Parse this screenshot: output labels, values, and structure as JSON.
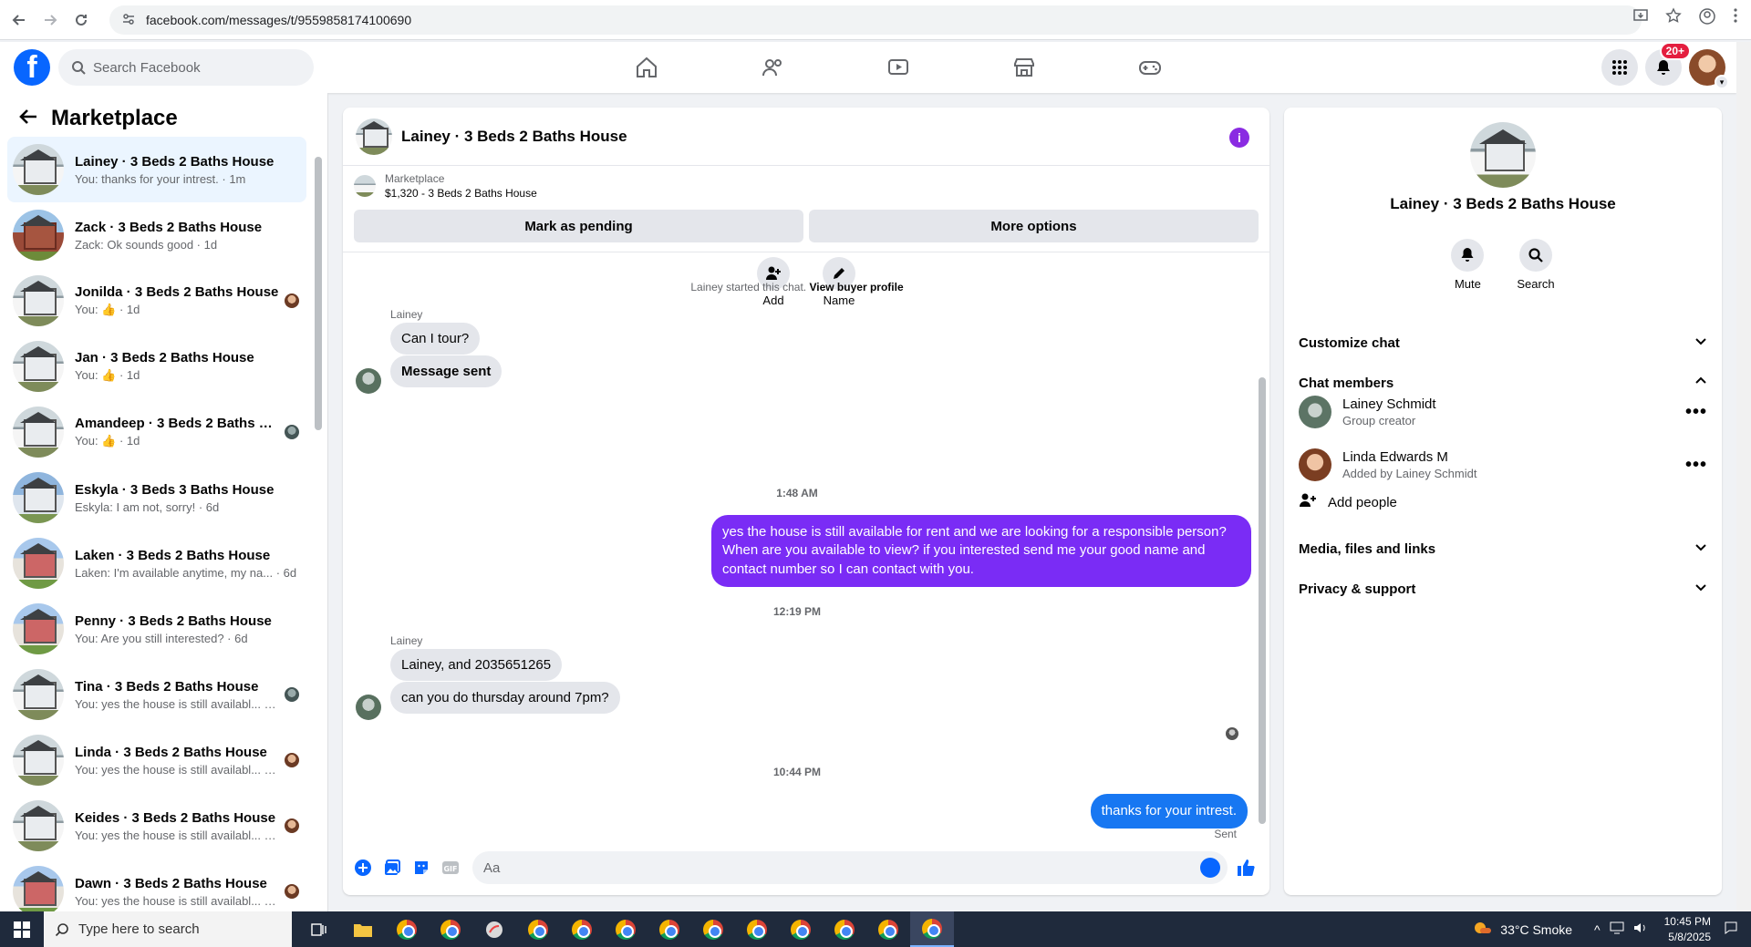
{
  "browser": {
    "url": "facebook.com/messages/t/9559858174100690"
  },
  "fb": {
    "search_placeholder": "Search Facebook",
    "notif_badge": "20+"
  },
  "left": {
    "title": "Marketplace",
    "conversations": [
      {
        "name": "Lainey · 3 Beds 2 Baths House",
        "preview": "You: thanks for your intrest. · 1m",
        "thumb": "house"
      },
      {
        "name": "Zack · 3 Beds 2 Baths House",
        "preview": "Zack: Ok sounds good · 1d",
        "thumb": "brick"
      },
      {
        "name": "Jonilda · 3 Beds 2 Baths House",
        "preview": "You: 👍 · 1d",
        "thumb": "house"
      },
      {
        "name": "Jan · 3 Beds 2 Baths House",
        "preview": "You: 👍 · 1d",
        "thumb": "house"
      },
      {
        "name": "Amandeep · 3 Beds 2 Baths H...",
        "preview": "You: 👍 · 1d",
        "thumb": "house"
      },
      {
        "name": "Eskyla · 3 Beds 3 Baths House",
        "preview": "Eskyla: I am not, sorry! · 6d",
        "thumb": "blue"
      },
      {
        "name": "Laken · 3 Beds 2 Baths House",
        "preview": "Laken: I'm available anytime, my na... · 6d",
        "thumb": "porch"
      },
      {
        "name": "Penny · 3 Beds 2 Baths House",
        "preview": "You: Are you still interested? · 6d",
        "thumb": "porch"
      },
      {
        "name": "Tina · 3 Beds 2 Baths House",
        "preview": "You: yes the house is still availabl... · 6d",
        "thumb": "house"
      },
      {
        "name": "Linda · 3 Beds 2 Baths House",
        "preview": "You: yes the house is still availabl... · 6d",
        "thumb": "house"
      },
      {
        "name": "Keides · 3 Beds 2 Baths House",
        "preview": "You: yes the house is still availabl... · 6d",
        "thumb": "house"
      },
      {
        "name": "Dawn · 3 Beds 2 Baths House",
        "preview": "You: yes the house is still availabl... · 6d",
        "thumb": "porch"
      }
    ]
  },
  "chat": {
    "title": "Lainey · 3 Beds 2 Baths House",
    "listing_source": "Marketplace",
    "listing_title": "$1,320 - 3 Beds 2 Baths House",
    "btn_pending": "Mark as pending",
    "btn_more": "More options",
    "quick_add": "Add",
    "quick_name": "Name",
    "started_text": "Lainey started this chat.",
    "view_profile": "View buyer profile",
    "sender1": "Lainey",
    "msg1": "Can I tour?",
    "msg2": "Message sent",
    "time1": "1:48 AM",
    "out1": "yes the house is still available for rent and we are looking for a responsible person? When are you available to view? if you interested send me your good name and contact number  so I can contact with you.",
    "time2": "12:19 PM",
    "sender2": "Lainey",
    "msg3": "Lainey, and 2035651265",
    "msg4": "can you do thursday around 7pm?",
    "time3": "10:44 PM",
    "out2": "thanks for your intrest.",
    "sent": "Sent",
    "composer_placeholder": "Aa",
    "out1_color": "#7a2cf5",
    "out2_color": "#1777f2"
  },
  "right": {
    "title": "Lainey · 3 Beds 2 Baths House",
    "mute": "Mute",
    "search": "Search",
    "customize": "Customize chat",
    "members_header": "Chat members",
    "members": [
      {
        "name": "Lainey Schmidt",
        "sub": "Group creator"
      },
      {
        "name": "Linda Edwards M",
        "sub": "Added by Lainey Schmidt"
      }
    ],
    "add_people": "Add people",
    "media": "Media, files and links",
    "privacy": "Privacy & support"
  },
  "taskbar": {
    "search": "Type here to search",
    "weather": "33°C  Smoke",
    "time": "10:45 PM",
    "date": "5/8/2025"
  }
}
